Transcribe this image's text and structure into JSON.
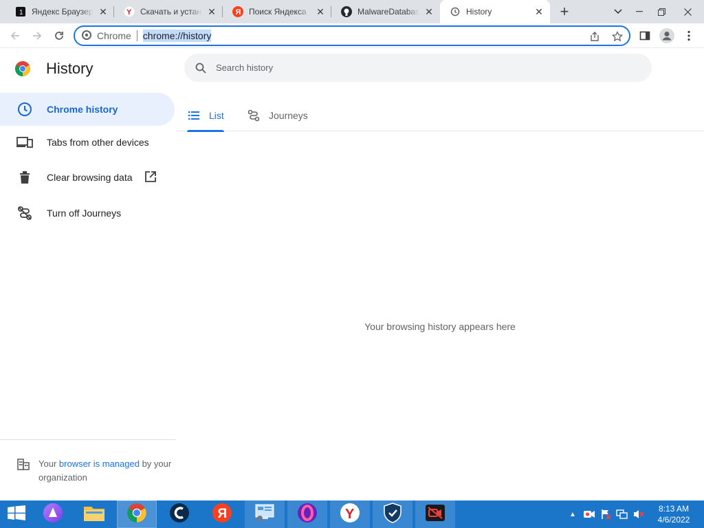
{
  "browser": {
    "tabs": [
      {
        "title": "Яндекс Браузер для",
        "favicon": "yandex-browser-icon"
      },
      {
        "title": "Скачать и установить",
        "favicon": "yandex-y-icon"
      },
      {
        "title": "Поиск Яндекса",
        "favicon": "yandex-search-icon"
      },
      {
        "title": "MalwareDatabase",
        "favicon": "github-icon"
      },
      {
        "title": "History",
        "favicon": "history-icon",
        "active": true
      }
    ],
    "omnibox": {
      "chip_label": "Chrome",
      "url": "chrome://history"
    }
  },
  "page": {
    "title": "History",
    "search_placeholder": "Search history",
    "sidebar": [
      {
        "label": "Chrome history",
        "icon": "clock-icon",
        "selected": true
      },
      {
        "label": "Tabs from other devices",
        "icon": "devices-icon"
      },
      {
        "label": "Clear browsing data",
        "icon": "trash-icon"
      },
      {
        "label": "Turn off Journeys",
        "icon": "journeys-off-icon"
      }
    ],
    "managed": {
      "prefix": "Your ",
      "link": "browser is managed",
      "suffix": " by your organization"
    },
    "tabs": [
      {
        "label": "List",
        "icon": "list-icon",
        "active": true
      },
      {
        "label": "Journeys",
        "icon": "journeys-icon"
      }
    ],
    "empty_message": "Your browsing history appears here"
  },
  "taskbar": {
    "time": "8:13 AM",
    "date": "4/6/2022"
  },
  "colors": {
    "accent": "#1a73e8",
    "selected_bg": "#e8f0fe",
    "tabstrip": "#dee1e6",
    "taskbar": "#1b76c9"
  }
}
